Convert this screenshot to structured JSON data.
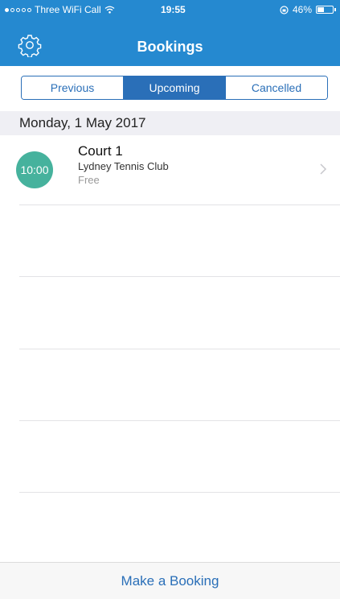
{
  "status_bar": {
    "carrier": "Three WiFi Call",
    "time": "19:55",
    "battery": "46%",
    "battery_level": 0.46
  },
  "header": {
    "title": "Bookings",
    "settings_icon": "gear-icon",
    "background_color": "#2589d0"
  },
  "tabs": [
    {
      "label": "Previous",
      "active": false
    },
    {
      "label": "Upcoming",
      "active": true
    },
    {
      "label": "Cancelled",
      "active": false
    }
  ],
  "bookings_section": {
    "date": "Monday, 1 May 2017",
    "items": [
      {
        "time": "10:00",
        "court": "Court 1",
        "club": "Lydney Tennis Club",
        "price": "Free",
        "time_circle_color": "#46b29d"
      }
    ]
  },
  "footer": {
    "make_booking_label": "Make a Booking"
  },
  "colors": {
    "accent": "#2a6fb8"
  }
}
